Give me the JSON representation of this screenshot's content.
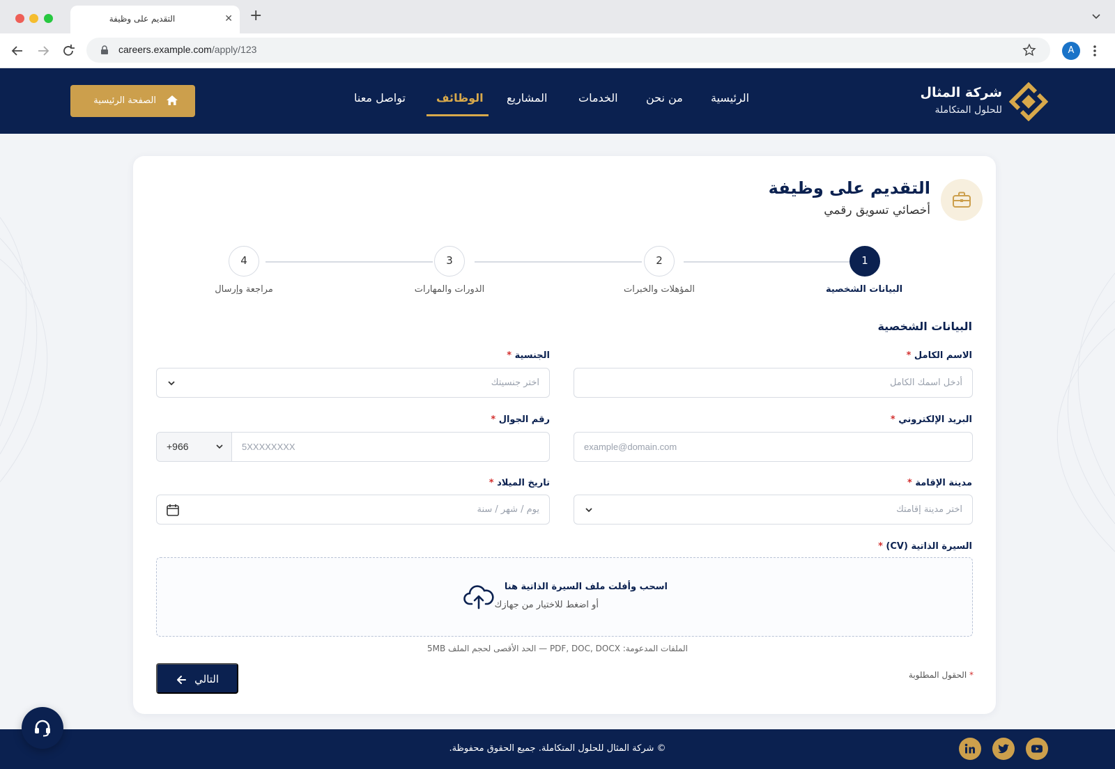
{
  "browser": {
    "tab_title": "التقديم على وظيفة",
    "url_domain": "careers.example.com",
    "url_path": "/apply/123",
    "profile_initial": "A"
  },
  "header": {
    "brand_name": "شركة المثال",
    "brand_tagline": "للحلول المتكاملة",
    "nav": {
      "home": "الرئيسية",
      "about": "من نحن",
      "services": "الخدمات",
      "projects": "المشاريع",
      "jobs": "الوظائف",
      "contact": "تواصل معنا"
    },
    "home_button": "الصفحة الرئيسية"
  },
  "page": {
    "title": "التقديم على وظيفة",
    "subtitle": "أخصائي تسويق رقمي"
  },
  "stepper": {
    "active_step": 1,
    "steps": [
      {
        "number": "1",
        "label": "البيانات الشخصية"
      },
      {
        "number": "2",
        "label": "المؤهلات والخبرات"
      },
      {
        "number": "3",
        "label": "الدورات والمهارات"
      },
      {
        "number": "4",
        "label": "مراجعة وإرسال"
      }
    ]
  },
  "form": {
    "section_title": "البيانات الشخصية",
    "required_mark": "*",
    "full_name": {
      "label": "الاسم الكامل",
      "placeholder": "أدخل اسمك الكامل"
    },
    "nationality": {
      "label": "الجنسية",
      "placeholder": "اختر جنسيتك"
    },
    "email": {
      "label": "البريد الإلكتروني",
      "placeholder": "example@domain.com"
    },
    "phone": {
      "label": "رقم الجوال",
      "country_code": "+966",
      "placeholder": "5XXXXXXXX"
    },
    "city": {
      "label": "مدينة الإقامة",
      "placeholder": "اختر مدينة إقامتك"
    },
    "birth_date": {
      "label": "تاريخ الميلاد",
      "placeholder": "يوم / شهر / سنة"
    },
    "cv": {
      "label": "السيرة الذاتية (CV)",
      "drop_title": "اسحب وأفلت ملف السيرة الذاتية هنا",
      "drop_subtitle": "أو اضغط للاختيار من جهازك",
      "hint": "الملفات المدعومة: PDF, DOC, DOCX — الحد الأقصى لحجم الملف 5MB"
    },
    "next_button": "التالي",
    "required_note": "الحقول المطلوبة"
  },
  "footer": {
    "copyright": "© شركة المثال للحلول المتكاملة. جميع الحقوق محفوظة.",
    "social": [
      "youtube-icon",
      "twitter-icon",
      "linkedin-icon"
    ]
  },
  "colors": {
    "navy": "#0b2150",
    "gold": "#cc9f4c",
    "gold_active": "#d8a94b",
    "required": "#d3302f"
  }
}
